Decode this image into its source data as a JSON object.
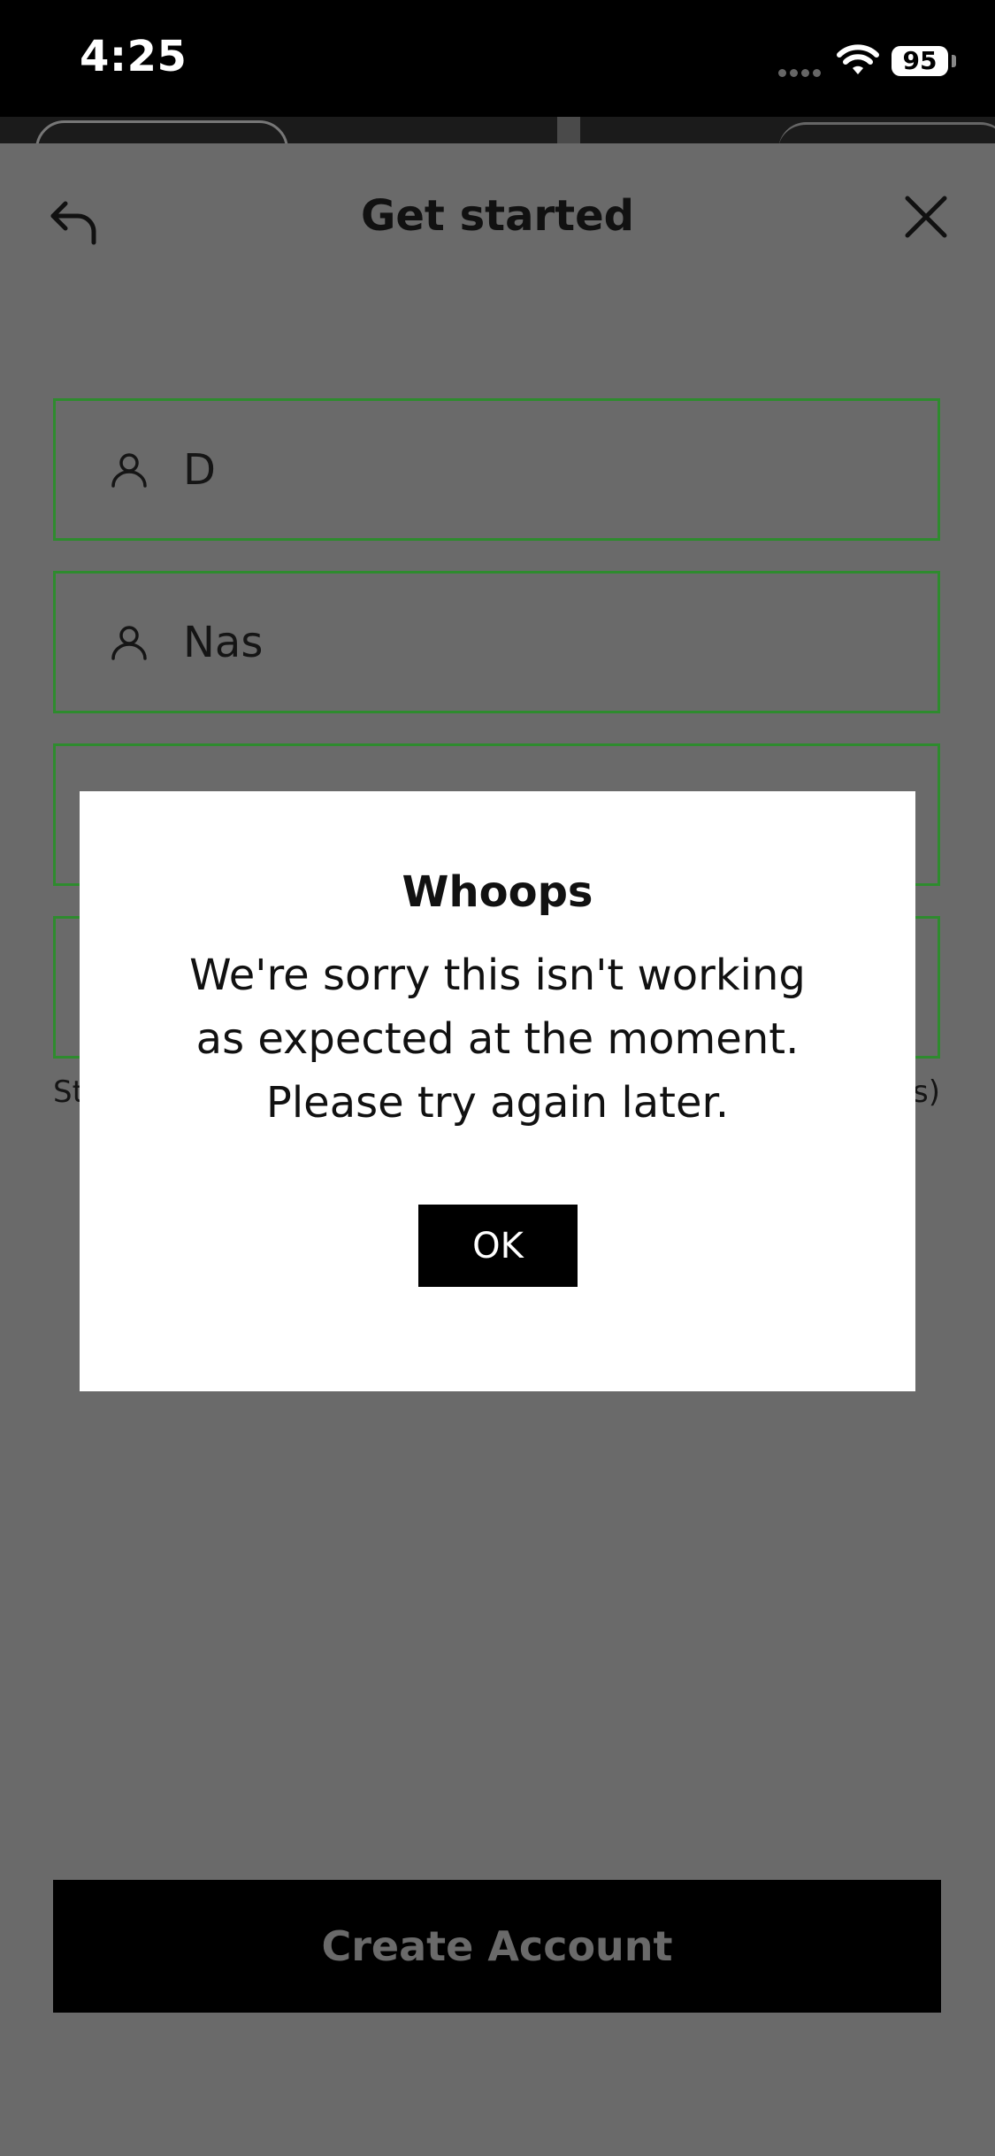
{
  "status_bar": {
    "time": "4:25",
    "battery": "95",
    "icons": [
      "signal-dots-icon",
      "wifi-icon",
      "battery-icon"
    ]
  },
  "header": {
    "title": "Get started",
    "back_icon": "back-arrow-icon",
    "close_icon": "close-icon"
  },
  "form": {
    "fields": [
      {
        "icon": "person-icon",
        "value": "D"
      },
      {
        "icon": "person-icon",
        "value": "Nas"
      },
      {
        "value": ""
      },
      {
        "value": ""
      }
    ],
    "hint_start": "St",
    "hint_end": "rs)"
  },
  "create_button": {
    "label": "Create Account"
  },
  "dialog": {
    "title": "Whoops",
    "message": "We're sorry this isn't working as expected at the moment. Please try again later.",
    "ok_label": "OK"
  },
  "colors": {
    "overlay": "#6a6a6a",
    "field_border": "#2e8b2e",
    "button_bg": "#000000",
    "dialog_bg": "#ffffff"
  }
}
